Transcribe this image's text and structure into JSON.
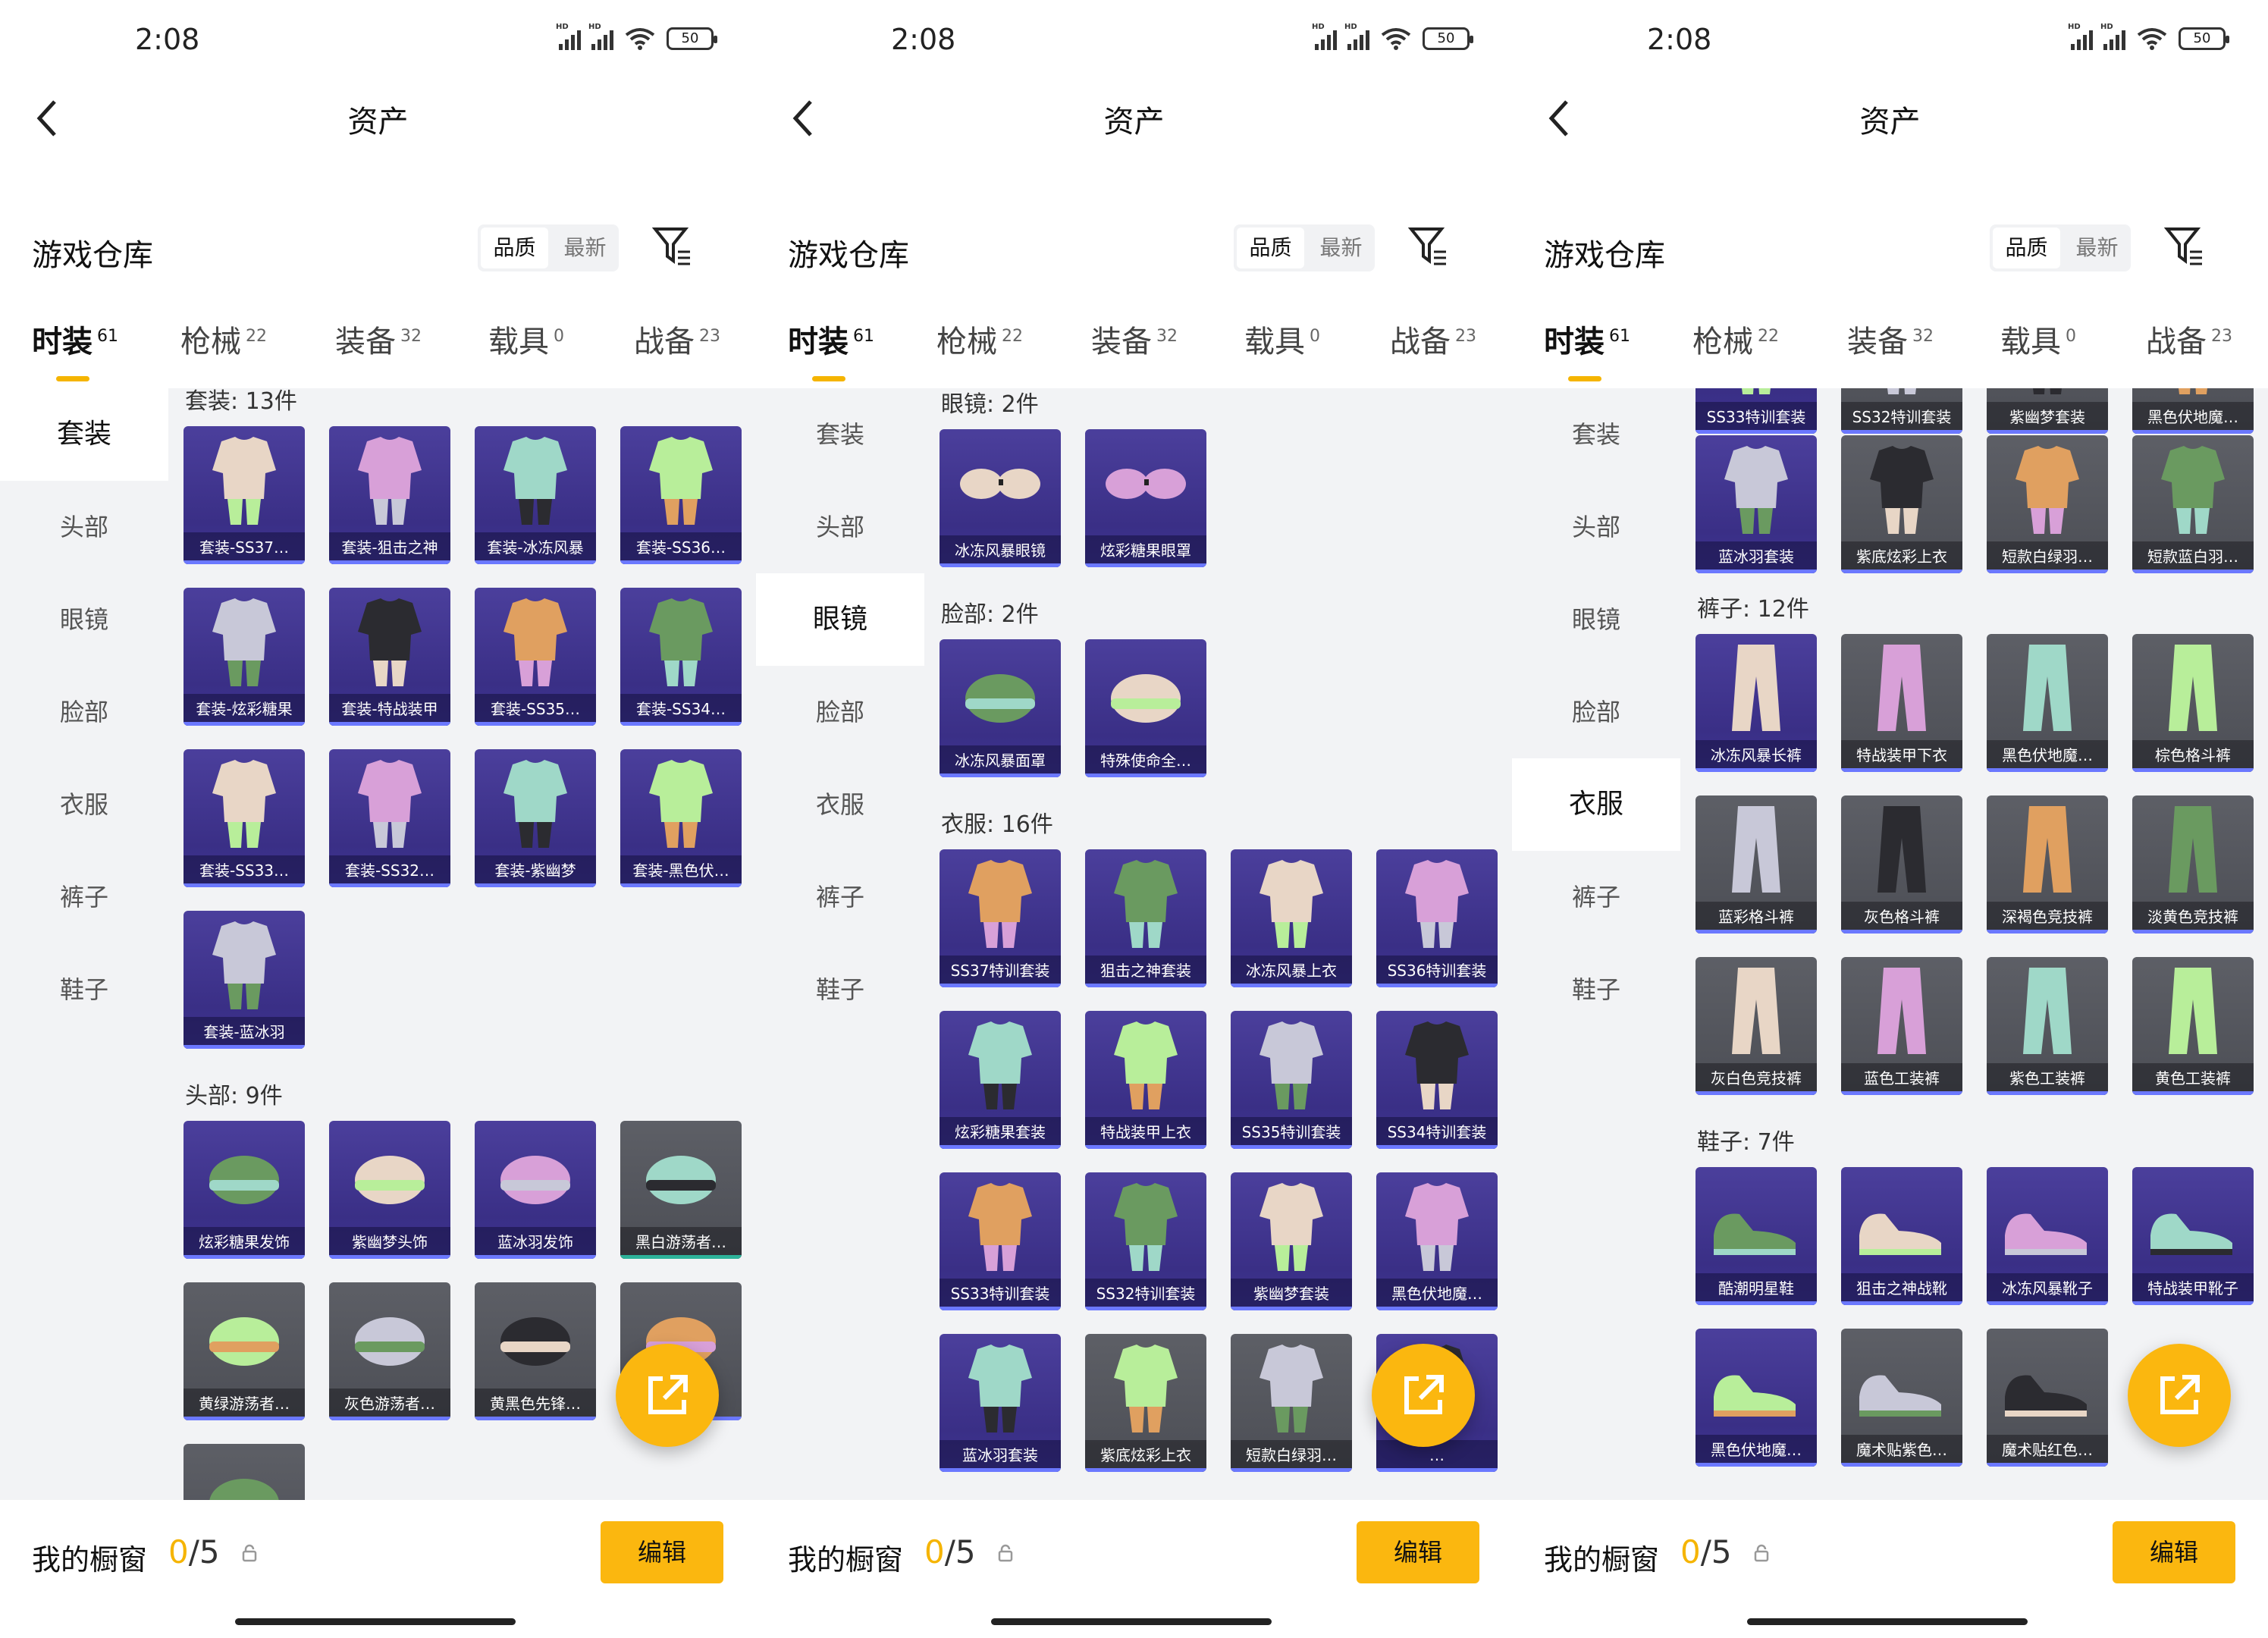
{
  "status": {
    "time": "2:08",
    "battery": "50"
  },
  "nav": {
    "title": "资产"
  },
  "header": {
    "warehouse": "游戏仓库",
    "sort_quality": "品质",
    "sort_latest": "最新"
  },
  "tabs": [
    {
      "label": "时装",
      "count": "61"
    },
    {
      "label": "枪械",
      "count": "22"
    },
    {
      "label": "装备",
      "count": "32"
    },
    {
      "label": "载具",
      "count": "0"
    },
    {
      "label": "战备",
      "count": "23"
    }
  ],
  "sidebar": [
    "套装",
    "头部",
    "眼镜",
    "脸部",
    "衣服",
    "裤子",
    "鞋子"
  ],
  "colors": {
    "accent": "#fbb70f",
    "purple_card": "#3a2f86",
    "gray_card": "#4c4e55"
  },
  "bottom": {
    "showcase": "我的橱窗",
    "count_used": "0",
    "count_total": "/5",
    "edit": "编辑"
  },
  "panel1": {
    "sections": [
      {
        "title": "套装: 13件",
        "items": [
          "套装-SS37…",
          "套装-狙击之神",
          "套装-冰冻风暴",
          "套装-SS36…",
          "套装-炫彩糖果",
          "套装-特战装甲",
          "套装-SS35…",
          "套装-SS34…",
          "套装-SS33…",
          "套装-SS32…",
          "套装-紫幽梦",
          "套装-黑色伏…",
          "套装-蓝冰羽"
        ]
      },
      {
        "title": "头部: 9件",
        "items": [
          "炫彩糖果发饰",
          "紫幽梦头饰",
          "蓝冰羽发饰",
          "黑白游荡者…",
          "黄绿游荡者…",
          "灰色游荡者…",
          "黄黑色先锋…",
          "",
          ""
        ]
      }
    ]
  },
  "panel2": {
    "sections": [
      {
        "title": "眼镜: 2件",
        "items": [
          "冰冻风暴眼镜",
          "炫彩糖果眼罩"
        ]
      },
      {
        "title": "脸部: 2件",
        "items": [
          "冰冻风暴面罩",
          "特殊使命全…"
        ]
      },
      {
        "title": "衣服: 16件",
        "items": [
          "SS37特训套装",
          "狙击之神套装",
          "冰冻风暴上衣",
          "SS36特训套装",
          "炫彩糖果套装",
          "特战装甲上衣",
          "SS35特训套装",
          "SS34特训套装",
          "SS33特训套装",
          "SS32特训套装",
          "紫幽梦套装",
          "黑色伏地魔…",
          "蓝冰羽套装",
          "紫底炫彩上衣",
          "短款白绿羽…",
          "…"
        ]
      },
      {
        "title": "裤子: 12件",
        "items": []
      }
    ]
  },
  "panel3": {
    "top_items": [
      "SS33特训套装",
      "SS32特训套装",
      "紫幽梦套装",
      "黑色伏地魔…",
      "蓝冰羽套装",
      "紫底炫彩上衣",
      "短款白绿羽…",
      "短款蓝白羽…"
    ],
    "sections": [
      {
        "title": "裤子: 12件",
        "items": [
          "冰冻风暴长裤",
          "特战装甲下衣",
          "黑色伏地魔…",
          "棕色格斗裤",
          "蓝彩格斗裤",
          "灰色格斗裤",
          "深褐色竞技裤",
          "淡黄色竞技裤",
          "灰白色竞技裤",
          "蓝色工装裤",
          "紫色工装裤",
          "黄色工装裤"
        ]
      },
      {
        "title": "鞋子: 7件",
        "items": [
          "酷潮明星鞋",
          "狙击之神战靴",
          "冰冻风暴靴子",
          "特战装甲靴子",
          "黑色伏地魔…",
          "魔术贴紫色…",
          "魔术贴红色…"
        ]
      }
    ]
  }
}
